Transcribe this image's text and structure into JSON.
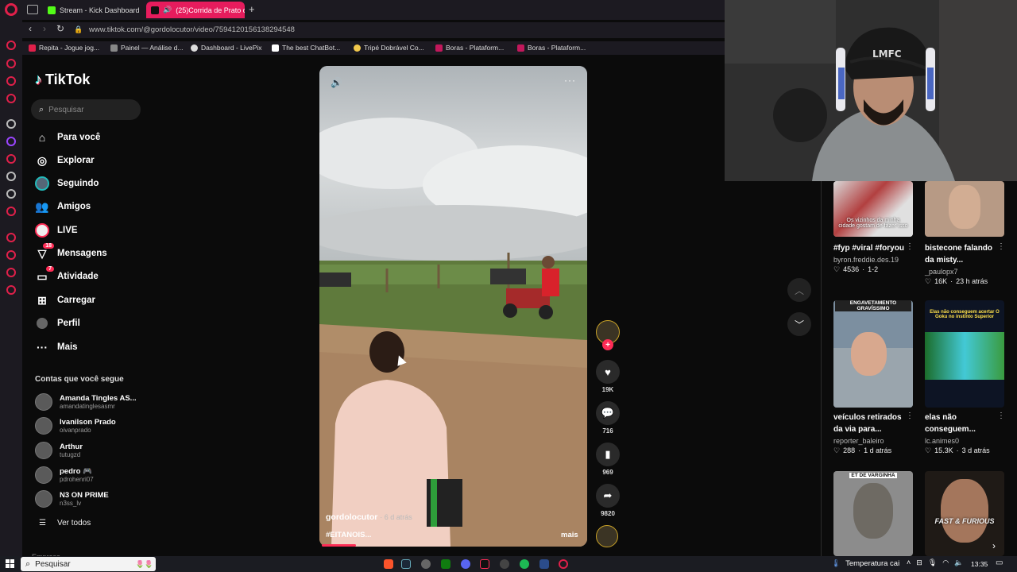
{
  "browser": {
    "tabs": [
      {
        "label": "Stream - Kick Dashboard",
        "active": false
      },
      {
        "label": "(25)Corrida de Prato d",
        "active": true
      }
    ],
    "url": "www.tiktok.com/@gordolocutor/video/7594120156138294548",
    "bookmarks": [
      "Repita - Jogue jog...",
      "Painel — Análise d...",
      "Dashboard - LivePix",
      "The best ChatBot...",
      "Tripé Dobrável Co...",
      "Boras - Plataform...",
      "Boras - Plataform..."
    ]
  },
  "tiktok": {
    "logo": "TikTok",
    "search_placeholder": "Pesquisar",
    "nav": [
      {
        "label": "Para você",
        "icon": "home-icon"
      },
      {
        "label": "Explorar",
        "icon": "compass-icon"
      },
      {
        "label": "Seguindo",
        "icon": "following-avatar-icon"
      },
      {
        "label": "Amigos",
        "icon": "friends-icon"
      },
      {
        "label": "LIVE",
        "icon": "live-icon"
      },
      {
        "label": "Mensagens",
        "icon": "messages-icon",
        "badge": "18"
      },
      {
        "label": "Atividade",
        "icon": "activity-icon",
        "badge": "7"
      },
      {
        "label": "Carregar",
        "icon": "upload-icon"
      },
      {
        "label": "Perfil",
        "icon": "profile-icon"
      },
      {
        "label": "Mais",
        "icon": "more-icon"
      }
    ],
    "following_header": "Contas que você segue",
    "following": [
      {
        "name": "Amanda Tingles AS...",
        "handle": "amandatinglesasmr"
      },
      {
        "name": "Ivanilson Prado",
        "handle": "oivanprado"
      },
      {
        "name": "Arthur",
        "handle": "tutugzd"
      },
      {
        "name": "pedro 🎮",
        "handle": "pdrohenri07"
      },
      {
        "name": "N3 ON PRIME",
        "handle": "n3ss_lv"
      }
    ],
    "see_all": "Ver todos",
    "sidebar_cut_text": "Empresa"
  },
  "video": {
    "author": "gordolocutor",
    "age": "· 6 d atrás",
    "caption": "#EITANOIS...",
    "more": "mais",
    "progress": 0.13,
    "likes": "19K",
    "comments": "716",
    "saves": "969",
    "shares": "9820"
  },
  "right_cards": [
    {
      "title": "#fyp #viral #foryou",
      "user": "byron.freddie.des.19",
      "likes": "4536",
      "time": "1-2",
      "thumb_text": "Os vizinhos da minha cidade gostam de fazer isso"
    },
    {
      "title": "bistecone falando da misty...",
      "user": "_paulopx7",
      "likes": "16K",
      "time": "23 h atrás",
      "thumb_text": ""
    },
    {
      "title": "veículos retirados da via para...",
      "user": "reporter_baleiro",
      "likes": "288",
      "time": "1 d atrás",
      "thumb_text": "ENGAVETAMENTO GRAVÍSSIMO"
    },
    {
      "title": "elas não conseguem...",
      "user": "lc.animes0",
      "likes": "15.3K",
      "time": "3 d atrás",
      "thumb_text": "Elas não conseguem acertar O Goku no instinto Superior"
    },
    {
      "title": "",
      "user": "",
      "likes": "",
      "time": "",
      "thumb_text": "ET DE VARGINHA"
    },
    {
      "title": "",
      "user": "",
      "likes": "",
      "time": "",
      "thumb_text": "FAST & FURIOUS"
    }
  ],
  "taskbar": {
    "search": "Pesquisar",
    "weather": "Temperatura cai",
    "time": "13:35"
  },
  "colors": {
    "accent": "#fe2c55",
    "tab_active": "#e61c5d",
    "opera_red": "#e0204a"
  }
}
